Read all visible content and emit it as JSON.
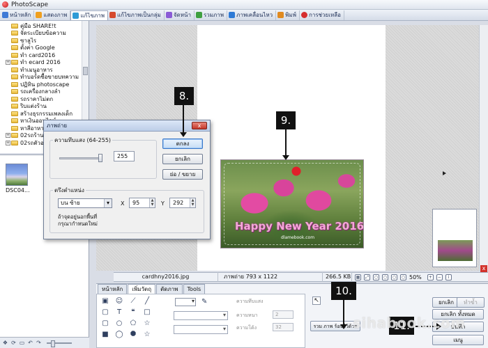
{
  "window": {
    "title": "PhotoScape"
  },
  "menu": [
    {
      "label": "หน้าหลัก",
      "color": "#3f7ad6"
    },
    {
      "label": "แสดงภาพ",
      "color": "#f0a020"
    },
    {
      "label": "แก้ไขภาพ",
      "color": "#2e9bd6",
      "active": true
    },
    {
      "label": "แก้ไขภาพเป็นกลุ่ม",
      "color": "#d64a2e"
    },
    {
      "label": "จัดหน้า",
      "color": "#8a5bd6"
    },
    {
      "label": "รวมภาพ",
      "color": "#3fa040"
    },
    {
      "label": "ภาพเคลื่อนไหว",
      "color": "#2e7ad6"
    },
    {
      "label": "พิมพ์",
      "color": "#e08a20"
    },
    {
      "label": "การช่วยเหลือ",
      "color": "#d62e2e"
    }
  ],
  "tree": [
    {
      "label": "คู่มือ SHARE!t",
      "expander": ""
    },
    {
      "label": "จัดระเบียบข้อความ",
      "expander": ""
    },
    {
      "label": "ซาลูไร",
      "expander": ""
    },
    {
      "label": "ตั้งค่า Google",
      "expander": ""
    },
    {
      "label": "ทำ card2016",
      "expander": ""
    },
    {
      "label": "ทำ ecard 2016",
      "expander": "+"
    },
    {
      "label": "ทำเมนูอาหาร",
      "expander": ""
    },
    {
      "label": "ทำบอร์ดชื้อขายบทความ",
      "expander": ""
    },
    {
      "label": "ปฏิทิน photoscape",
      "expander": ""
    },
    {
      "label": "รถเครื่องกลางลำ",
      "expander": ""
    },
    {
      "label": "รถราคาไม่ตก",
      "expander": ""
    },
    {
      "label": "ริบแต่งร้าน",
      "expander": ""
    },
    {
      "label": "สร้างธุรกรรมเพลงเด็ก",
      "expander": ""
    },
    {
      "label": "หาเงินออนไลน์",
      "expander": ""
    },
    {
      "label": "หาสีอาหาร",
      "expander": ""
    },
    {
      "label": "02รถร้านกาแฟ",
      "expander": "+"
    },
    {
      "label": "02รถตัวอย่าง",
      "expander": "+"
    }
  ],
  "thumbnail": {
    "label": "DSC04..."
  },
  "dialog": {
    "title": "ภาพถ่าย",
    "close_label": "x",
    "brightness_label": "ความทึบแสง (64-255)",
    "brightness_value": "255",
    "brightness_level": 1.0,
    "ok_label": "ตกลง",
    "cancel_label": "ยกเลิก",
    "resize_label": "ย่อ / ขยาย",
    "position_label": "ตรึงตำแหน่ง",
    "position_select": "บน ซ้าย",
    "x_label": "X",
    "x_value": "95",
    "y_label": "Y",
    "y_value": "292",
    "note_line1": "ถ้าจุดอยู่นอกพื้นที่",
    "note_line2": "กรุณากำหนดใหม่"
  },
  "photo": {
    "title": "Happy New Year 2016",
    "watermark": "dlamebook.com"
  },
  "status": {
    "filename": "cardhny2016.jpg",
    "dimensions": "ภาพถ่าย 793 x 1122",
    "filesize": "266.5 KB",
    "zoom": "50%"
  },
  "edit_tabs": [
    {
      "label": "หน้าหลัก",
      "active": false
    },
    {
      "label": "เพิ่มวัตถุ",
      "active": true
    },
    {
      "label": "ตัดภาพ",
      "active": false
    },
    {
      "label": "Tools",
      "active": false
    }
  ],
  "object_panel": {
    "opacity_label": "ความทึบแสง",
    "thickness_label": "ความหนา",
    "thickness_value": "2",
    "roundness_label": "ความโค้ง",
    "roundness_value": "32",
    "merge_label": "รวม ภาพ ร้อนไว้ด้วย"
  },
  "actions": {
    "undo_label": "ยกเลิก",
    "redo_label": "ทำซ้ำ",
    "undo_all_label": "ยกเลิก ทั้งหมด",
    "save_label": "บันทึก",
    "menu_label": "เมนู"
  },
  "steps": {
    "s8": "8.",
    "s9": "9.",
    "s10": "10.",
    "s11": "11."
  },
  "site_watermark": "sihabook.com"
}
